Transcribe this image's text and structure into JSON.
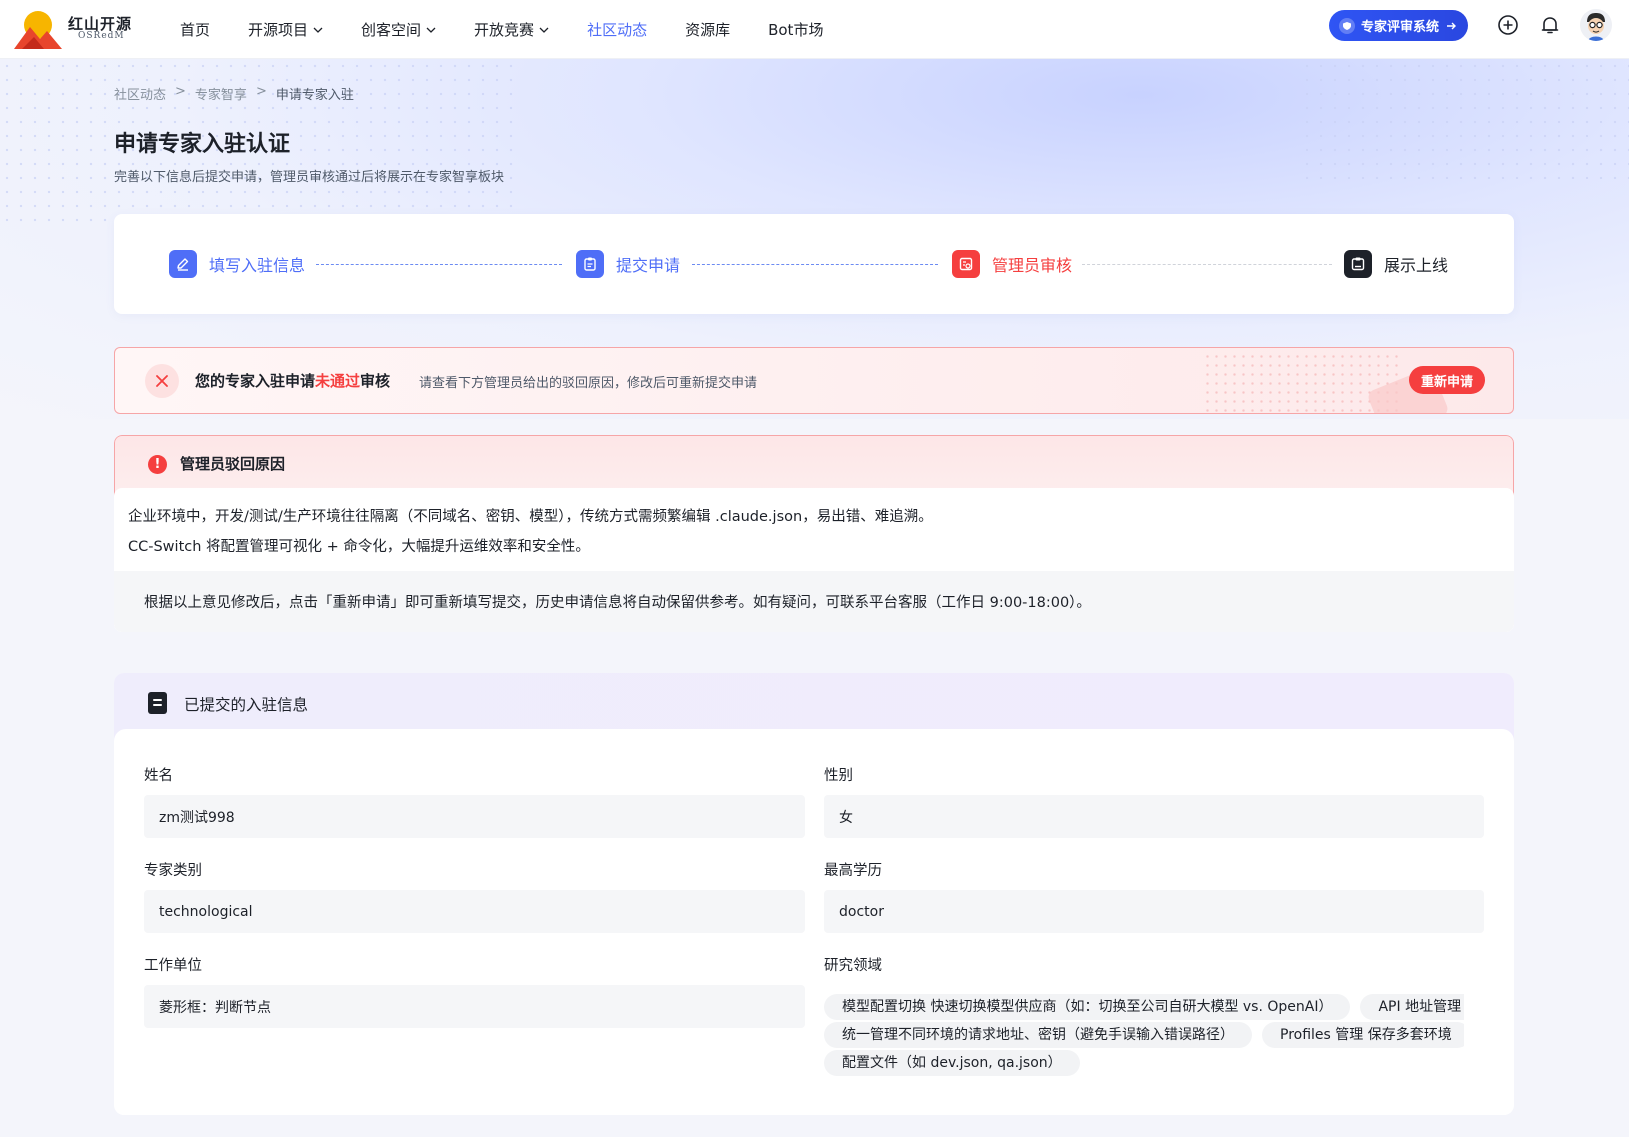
{
  "brand": {
    "name_cn": "红山开源",
    "name_en": "OSRedM"
  },
  "nav": {
    "items": [
      {
        "label": "首页",
        "dropdown": false,
        "active": false
      },
      {
        "label": "开源项目",
        "dropdown": true,
        "active": false
      },
      {
        "label": "创客空间",
        "dropdown": true,
        "active": false
      },
      {
        "label": "开放竞赛",
        "dropdown": true,
        "active": false
      },
      {
        "label": "社区动态",
        "dropdown": false,
        "active": true
      },
      {
        "label": "资源库",
        "dropdown": false,
        "active": false
      },
      {
        "label": "Bot市场",
        "dropdown": false,
        "active": false
      }
    ],
    "expert_button": "专家评审系统",
    "icons": [
      "plus-circle-icon",
      "bell-icon",
      "avatar"
    ]
  },
  "breadcrumb": [
    "社区动态",
    "专家智享",
    "申请专家入驻"
  ],
  "page": {
    "title": "申请专家入驻认证",
    "subtitle": "完善以下信息后提交申请，管理员审核通过后将展示在专家智享板块"
  },
  "steps": [
    {
      "label": "填写入驻信息",
      "state": "done",
      "icon": "edit-icon"
    },
    {
      "label": "提交申请",
      "state": "done",
      "icon": "clipboard-icon"
    },
    {
      "label": "管理员审核",
      "state": "rejected",
      "icon": "review-icon"
    },
    {
      "label": "展示上线",
      "state": "pending",
      "icon": "publish-icon"
    }
  ],
  "rejection": {
    "title_prefix": "您的专家入驻申请",
    "title_highlight": "未通过",
    "title_suffix": "审核",
    "description": "请查看下方管理员给出的驳回原因，修改后可重新提交申请",
    "reapply_button": "重新申请"
  },
  "reason": {
    "title": "管理员驳回原因",
    "lines": [
      "企业环境中，开发/测试/生产环境往往隔离（不同域名、密钥、模型），传统方式需频繁编辑 .claude.json，易出错、难追溯。",
      "CC-Switch 将配置管理可视化 + 命令化，大幅提升运维效率和安全性。"
    ],
    "note": "根据以上意见修改后，点击「重新申请」即可重新填写提交，历史申请信息将自动保留供参考。如有疑问，可联系平台客服（工作日 9:00-18:00）。"
  },
  "submitted": {
    "title": "已提交的入驻信息",
    "fields": {
      "name": {
        "label": "姓名",
        "value": "zm测试998"
      },
      "gender": {
        "label": "性别",
        "value": "女"
      },
      "category": {
        "label": "专家类别",
        "value": "technological"
      },
      "education": {
        "label": "最高学历",
        "value": "doctor"
      },
      "employer": {
        "label": "工作单位",
        "value": "菱形框：判断节点"
      },
      "research": {
        "label": "研究领域",
        "tags": [
          "模型配置切换 快速切换模型供应商（如：切换至公司自研大模型 vs. OpenAI）",
          "API 地址管理 统一管理不同环境的请求地址、密钥（避免手误输入错误路径）",
          "Profiles 管理 保存多套环境配置文件（如 dev.json, qa.json）"
        ]
      }
    }
  },
  "colors": {
    "primary": "#4f6ef7",
    "danger": "#f53f3f",
    "text": "#1d2129",
    "muted": "#86909c"
  }
}
